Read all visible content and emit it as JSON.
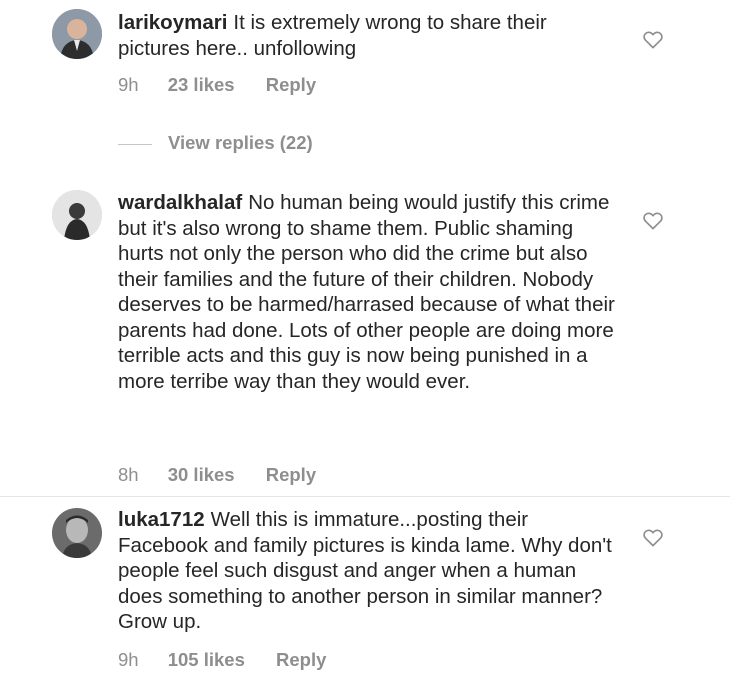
{
  "comments": [
    {
      "username": "larikoymari",
      "text": "It is extremely wrong to share their pictures here.. unfollowing",
      "time": "9h",
      "likes": "23 likes",
      "reply": "Reply"
    },
    {
      "username": "wardalkhalaf",
      "text": "No human being would justify this crime but it's also wrong to shame them. Public shaming hurts not only the person who did the crime but also their families and the future of their children. Nobody deserves to be harmed/harrased because of what their parents had done. Lots of other people are doing more terrible acts and this guy is now being punished in a more terribe way than they would ever.",
      "time": "8h",
      "likes": "30 likes",
      "reply": "Reply"
    },
    {
      "username": "luka1712",
      "text": "Well this is immature...posting their Facebook and family pictures is kinda lame. Why don't people feel such disgust and anger when a human does something to another person in similar manner? Grow up.",
      "time": "9h",
      "likes": "105 likes",
      "reply": "Reply"
    }
  ],
  "view_replies": "View replies (22)",
  "icons": {
    "like": "heart-outline-icon"
  },
  "colors": {
    "text": "#262626",
    "muted": "#8e8e8e"
  }
}
